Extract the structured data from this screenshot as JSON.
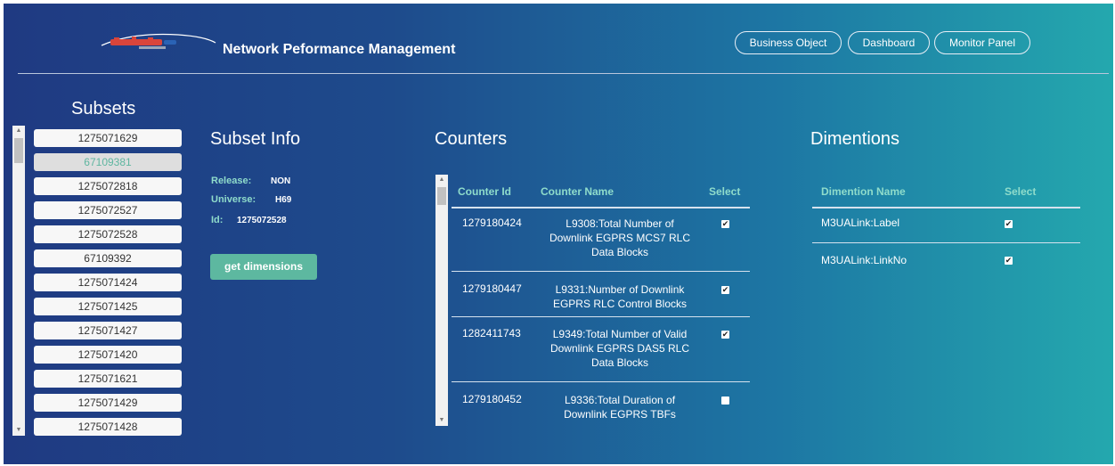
{
  "header": {
    "title": "Network Peformance Management",
    "nav": [
      "Business Object",
      "Dashboard",
      "Monitor Panel"
    ]
  },
  "subsets": {
    "title": "Subsets",
    "items": [
      "1275071629",
      "67109381",
      "1275072818",
      "1275072527",
      "1275072528",
      "67109392",
      "1275071424",
      "1275071425",
      "1275071427",
      "1275071420",
      "1275071621",
      "1275071429",
      "1275071428"
    ],
    "active_index": 1
  },
  "subset_info": {
    "title": "Subset Info",
    "release_label": "Release:",
    "release_value": "NON",
    "universe_label": "Universe:",
    "universe_value": "H69",
    "id_label": "Id:",
    "id_value": "1275072528",
    "button_label": "get dimensions"
  },
  "counters": {
    "title": "Counters",
    "columns": [
      "Counter Id",
      "Counter Name",
      "Select"
    ],
    "rows": [
      {
        "id": "1279180424",
        "name": [
          "L9308:Total Number of",
          "Downlink EGPRS MCS7 RLC",
          "Data Blocks"
        ],
        "selected": true
      },
      {
        "id": "1279180447",
        "name": [
          "L9331:Number of Downlink",
          "EGPRS RLC Control Blocks"
        ],
        "selected": true
      },
      {
        "id": "1282411743",
        "name": [
          "L9349:Total Number of Valid",
          "Downlink EGPRS DAS5 RLC",
          "Data Blocks"
        ],
        "selected": true
      },
      {
        "id": "1279180452",
        "name": [
          "L9336:Total Duration of",
          "Downlink EGPRS TBFs"
        ],
        "selected": false
      }
    ]
  },
  "dimentions": {
    "title": "Dimentions",
    "columns": [
      "Dimention Name",
      "Select"
    ],
    "rows": [
      {
        "name": "M3UALink:Label",
        "selected": true
      },
      {
        "name": "M3UALink:LinkNo",
        "selected": true
      }
    ]
  },
  "colors": {
    "accent": "#5db8a0",
    "header_text": "#8fdccb",
    "bg_start": "#1f3a82",
    "bg_end": "#24a8ae"
  }
}
